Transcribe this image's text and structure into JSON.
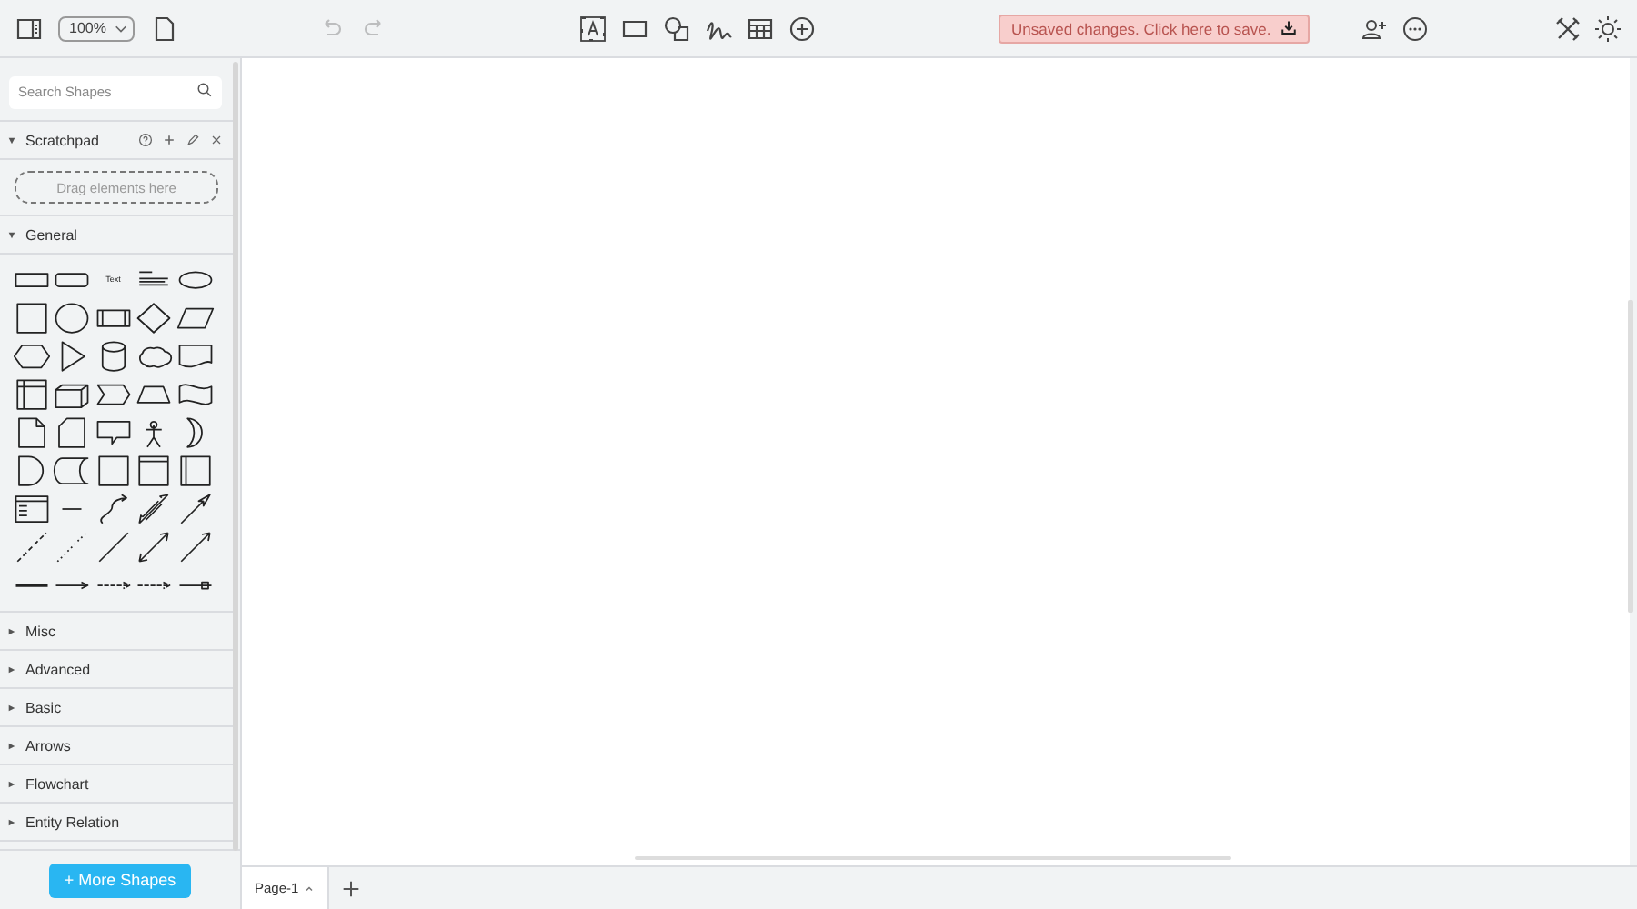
{
  "toolbar": {
    "zoom": "100%",
    "undo": {
      "disabled": true
    },
    "redo": {
      "disabled": true
    },
    "save_notice": "Unsaved changes. Click here to save."
  },
  "sidebar": {
    "search": {
      "placeholder": "Search Shapes"
    },
    "scratchpad": {
      "title": "Scratchpad",
      "expanded": true,
      "drop_hint": "Drag elements here"
    },
    "sections": [
      {
        "title": "General",
        "expanded": true,
        "shapes": [
          {
            "kind": "rectangle"
          },
          {
            "kind": "rounded"
          },
          {
            "kind": "text",
            "label": "Text"
          },
          {
            "kind": "textbox"
          },
          {
            "kind": "ellipse"
          },
          {
            "kind": "square"
          },
          {
            "kind": "circle"
          },
          {
            "kind": "process"
          },
          {
            "kind": "diamond"
          },
          {
            "kind": "parallelogram"
          },
          {
            "kind": "hexagon"
          },
          {
            "kind": "triangle"
          },
          {
            "kind": "cylinder"
          },
          {
            "kind": "cloud"
          },
          {
            "kind": "document"
          },
          {
            "kind": "storage"
          },
          {
            "kind": "cube"
          },
          {
            "kind": "step"
          },
          {
            "kind": "trapezoid"
          },
          {
            "kind": "tape"
          },
          {
            "kind": "note"
          },
          {
            "kind": "card"
          },
          {
            "kind": "callout"
          },
          {
            "kind": "actor"
          },
          {
            "kind": "or"
          },
          {
            "kind": "delay"
          },
          {
            "kind": "datastore"
          },
          {
            "kind": "square"
          },
          {
            "kind": "frame"
          },
          {
            "kind": "swimlane"
          },
          {
            "kind": "list"
          },
          {
            "kind": "listitem"
          },
          {
            "kind": "curve"
          },
          {
            "kind": "doublearrow"
          },
          {
            "kind": "arrow"
          },
          {
            "kind": "dashed"
          },
          {
            "kind": "dotted"
          },
          {
            "kind": "line"
          },
          {
            "kind": "bidirectional"
          },
          {
            "kind": "directional"
          },
          {
            "kind": "thick"
          },
          {
            "kind": "link1"
          },
          {
            "kind": "link2"
          },
          {
            "kind": "link3"
          },
          {
            "kind": "link4"
          }
        ]
      },
      {
        "title": "Misc",
        "expanded": false
      },
      {
        "title": "Advanced",
        "expanded": false
      },
      {
        "title": "Basic",
        "expanded": false
      },
      {
        "title": "Arrows",
        "expanded": false
      },
      {
        "title": "Flowchart",
        "expanded": false
      },
      {
        "title": "Entity Relation",
        "expanded": false
      }
    ],
    "more_button": "+ More Shapes"
  },
  "pages": [
    {
      "label": "Page-1",
      "selected": true
    }
  ]
}
